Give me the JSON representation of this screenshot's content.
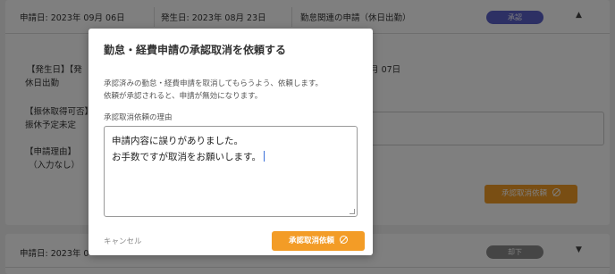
{
  "background": {
    "card1": {
      "application_date": "申請日: 2023年 09月 06日",
      "occurrence_date": "発生日: 2023年 08月 23日",
      "application_type": "勤怠関連の申請（休日出勤）",
      "status_badge": "承認",
      "status_color": "#5b61c9",
      "occurrence_label": "【発生日】【発",
      "occurrence_value": "休日出勤",
      "date_fragment": "9月 07日",
      "substitute_label": "【振休取得可否】",
      "substitute_value": "振休予定未定",
      "reason_label": "【申請理由】",
      "reason_value": "（入力なし）",
      "request_button": "承認取消依頼"
    },
    "card2": {
      "application_date": "申請日: 2023年 0",
      "status_badge": "却下",
      "status_color": "#8a8a8a"
    }
  },
  "modal": {
    "title": "勤怠・経費申請の承認取消を依頼する",
    "description_line1": "承認済みの勤怠・経費申請を取消してもらうよう、依頼します。",
    "description_line2": "依頼が承認されると、申請が無効になります。",
    "reason_label": "承認取消依頼の理由",
    "reason_line1": "申請内容に誤りがありました。",
    "reason_line2": "お手数ですが取消をお願いします。",
    "cancel_label": "キャンセル",
    "submit_label": "承認取消依頼",
    "accent_color": "#f39c26"
  }
}
